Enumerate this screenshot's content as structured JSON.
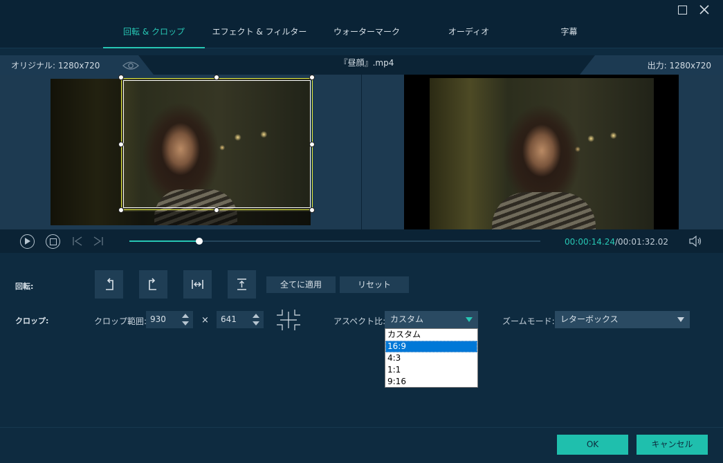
{
  "tabs": [
    {
      "label": "回転 & クロップ",
      "active": true
    },
    {
      "label": "エフェクト & フィルター",
      "active": false
    },
    {
      "label": "ウォーターマーク",
      "active": false
    },
    {
      "label": "オーディオ",
      "active": false
    },
    {
      "label": "字幕",
      "active": false
    }
  ],
  "preview": {
    "original_label": "オリジナル: 1280x720",
    "output_label": "出力: 1280x720",
    "filename": "『昼顔』.mp4"
  },
  "playback": {
    "current_time": "00:00:14.24",
    "total_time": "/00:01:32.02",
    "progress": 0.17
  },
  "rotation": {
    "label": "回転:",
    "apply_all": "全てに適用",
    "reset": "リセット"
  },
  "crop": {
    "label": "クロップ:",
    "range_label": "クロップ範囲:",
    "width": "930",
    "times": "×",
    "height": "641",
    "aspect_label": "アスペクト比:",
    "aspect_value": "カスタム",
    "aspect_options": [
      "カスタム",
      "16:9",
      "4:3",
      "1:1",
      "9:16"
    ],
    "aspect_highlighted": "16:9",
    "zoom_label": "ズームモード:",
    "zoom_value": "レターボックス"
  },
  "footer": {
    "ok": "OK",
    "cancel": "キャンセル"
  },
  "colors": {
    "accent": "#27c7b4",
    "background": "#0e2b40",
    "crop_border": "#e8ee3c"
  }
}
